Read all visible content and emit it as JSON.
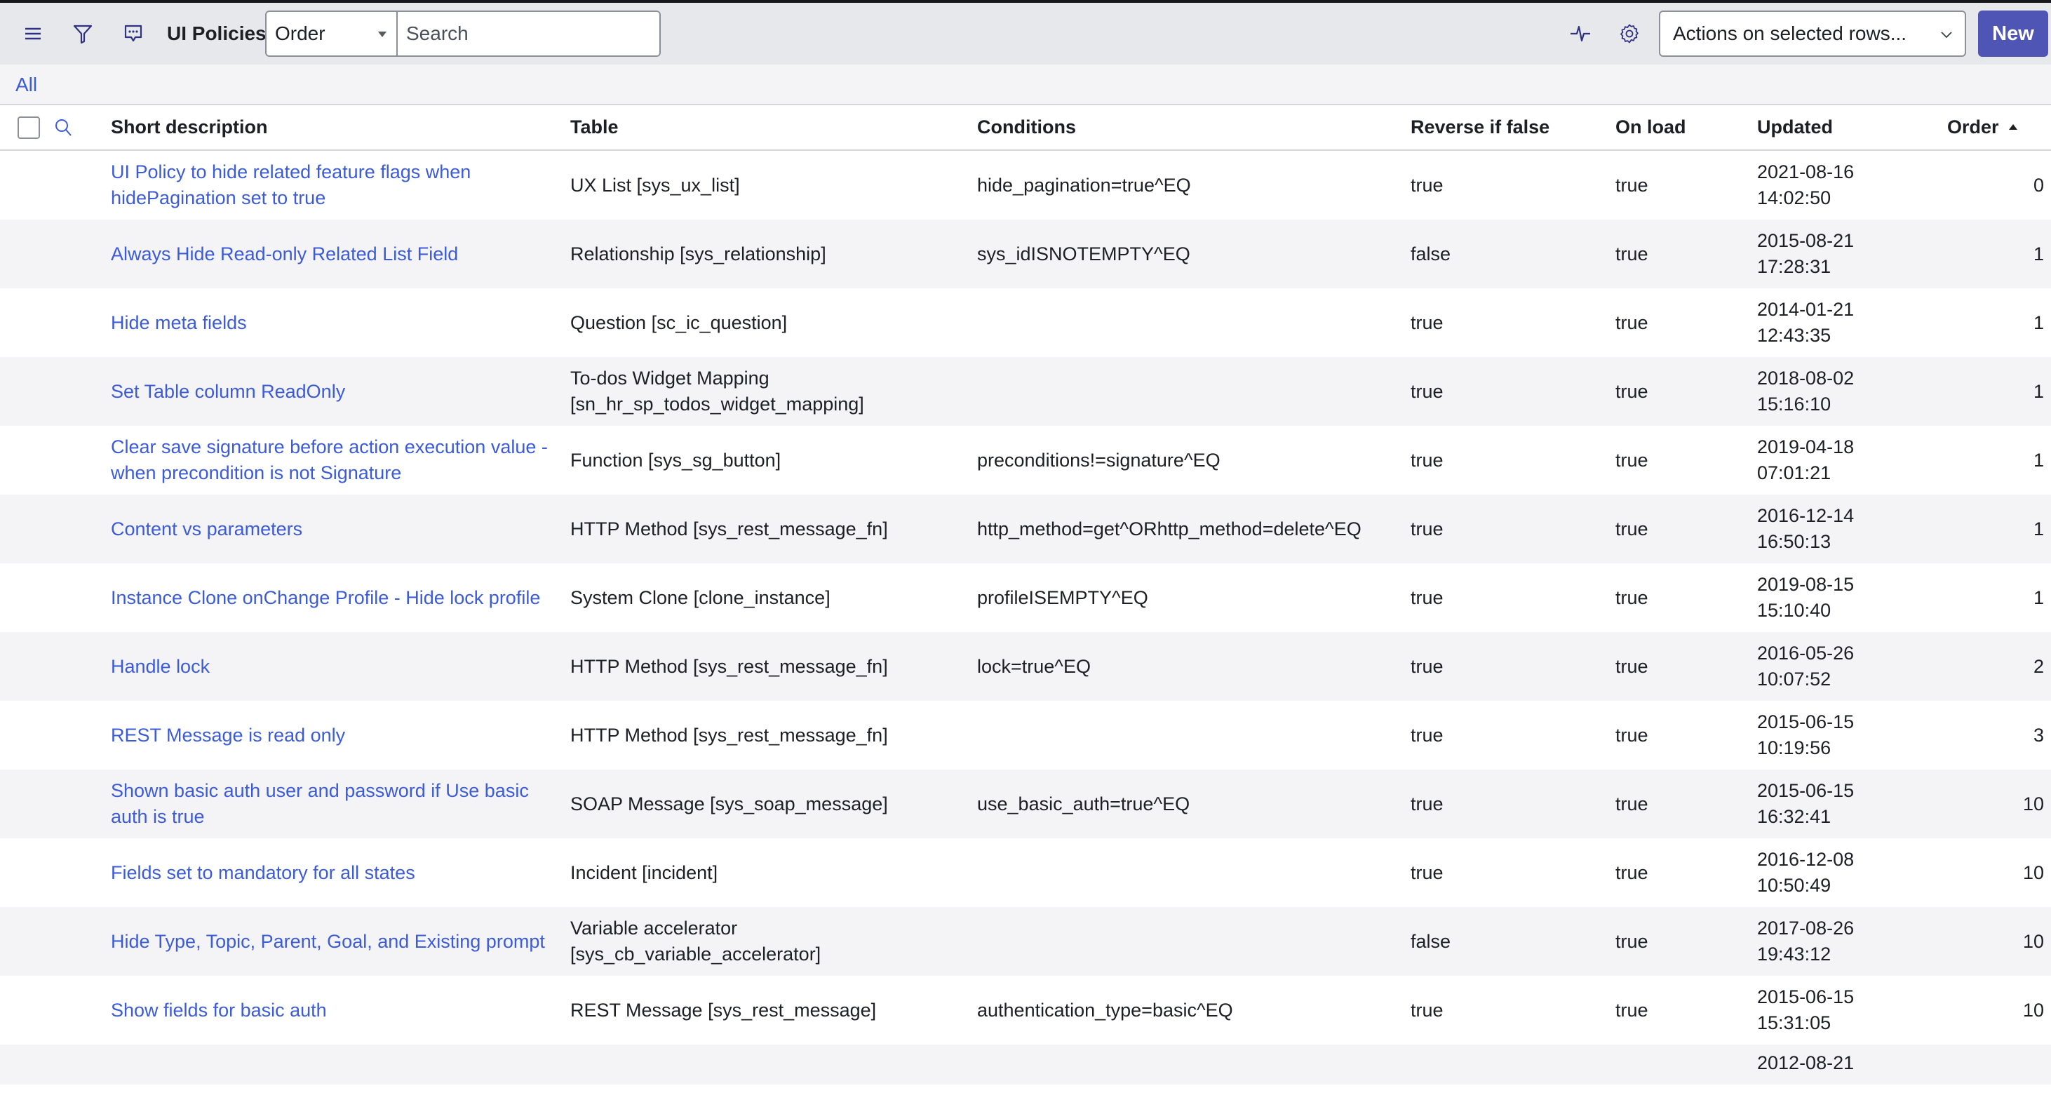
{
  "toolbar": {
    "menu_icon": "hamburger-menu-icon",
    "filter_icon": "filter-funnel-icon",
    "comment_icon": "chat-bubble-icon",
    "title": "UI Policies",
    "search_field_select": "Order",
    "search_placeholder": "Search",
    "pulse_icon": "activity-pulse-icon",
    "settings_icon": "gear-icon",
    "actions_select": "Actions on selected rows...",
    "new_button": "New"
  },
  "colors": {
    "link": "#3c5bd9",
    "primary_button": "#4f55b5",
    "toolbar_bg": "#e7e8ec",
    "stripe_bg": "#f4f4f6"
  },
  "filter": {
    "breadcrumb_all": "All"
  },
  "table": {
    "columns": [
      {
        "label": "Short description"
      },
      {
        "label": "Table"
      },
      {
        "label": "Conditions"
      },
      {
        "label": "Reverse if false"
      },
      {
        "label": "On load"
      },
      {
        "label": "Updated"
      },
      {
        "label": "Order",
        "sort": "ascending"
      }
    ],
    "rows": [
      {
        "short_description": "UI Policy to hide related feature flags when hidePagination set to true",
        "table": "UX List [sys_ux_list]",
        "conditions": "hide_pagination=true^EQ",
        "reverse_if_false": "true",
        "on_load": "true",
        "updated_date": "2021-08-16",
        "updated_time": "14:02:50",
        "order": "0"
      },
      {
        "short_description": "Always Hide Read-only Related List Field",
        "table": "Relationship [sys_relationship]",
        "conditions": "sys_idISNOTEMPTY^EQ",
        "reverse_if_false": "false",
        "on_load": "true",
        "updated_date": "2015-08-21",
        "updated_time": "17:28:31",
        "order": "1"
      },
      {
        "short_description": "Hide meta fields",
        "table": "Question [sc_ic_question]",
        "conditions": "",
        "reverse_if_false": "true",
        "on_load": "true",
        "updated_date": "2014-01-21",
        "updated_time": "12:43:35",
        "order": "1"
      },
      {
        "short_description": "Set Table column ReadOnly",
        "table": "To-dos Widget Mapping [sn_hr_sp_todos_widget_mapping]",
        "conditions": "",
        "reverse_if_false": "true",
        "on_load": "true",
        "updated_date": "2018-08-02",
        "updated_time": "15:16:10",
        "order": "1"
      },
      {
        "short_description": "Clear save signature before action execution value - when precondition is not Signature",
        "table": "Function [sys_sg_button]",
        "conditions": "preconditions!=signature^EQ",
        "reverse_if_false": "true",
        "on_load": "true",
        "updated_date": "2019-04-18",
        "updated_time": "07:01:21",
        "order": "1"
      },
      {
        "short_description": "Content vs parameters",
        "table": "HTTP Method [sys_rest_message_fn]",
        "conditions": "http_method=get^ORhttp_method=delete^EQ",
        "reverse_if_false": "true",
        "on_load": "true",
        "updated_date": "2016-12-14",
        "updated_time": "16:50:13",
        "order": "1"
      },
      {
        "short_description": "Instance Clone onChange Profile - Hide lock profile",
        "table": "System Clone [clone_instance]",
        "conditions": "profileISEMPTY^EQ",
        "reverse_if_false": "true",
        "on_load": "true",
        "updated_date": "2019-08-15",
        "updated_time": "15:10:40",
        "order": "1"
      },
      {
        "short_description": "Handle lock",
        "table": "HTTP Method [sys_rest_message_fn]",
        "conditions": "lock=true^EQ",
        "reverse_if_false": "true",
        "on_load": "true",
        "updated_date": "2016-05-26",
        "updated_time": "10:07:52",
        "order": "2"
      },
      {
        "short_description": "REST Message is read only",
        "table": "HTTP Method [sys_rest_message_fn]",
        "conditions": "",
        "reverse_if_false": "true",
        "on_load": "true",
        "updated_date": "2015-06-15",
        "updated_time": "10:19:56",
        "order": "3"
      },
      {
        "short_description": "Shown basic auth user and password if Use basic auth is true",
        "table": "SOAP Message [sys_soap_message]",
        "conditions": "use_basic_auth=true^EQ",
        "reverse_if_false": "true",
        "on_load": "true",
        "updated_date": "2015-06-15",
        "updated_time": "16:32:41",
        "order": "10"
      },
      {
        "short_description": "Fields set to mandatory for all states",
        "table": "Incident [incident]",
        "conditions": "",
        "reverse_if_false": "true",
        "on_load": "true",
        "updated_date": "2016-12-08",
        "updated_time": "10:50:49",
        "order": "10"
      },
      {
        "short_description": "Hide Type, Topic, Parent, Goal, and Existing prompt",
        "table": "Variable accelerator [sys_cb_variable_accelerator]",
        "conditions": "",
        "reverse_if_false": "false",
        "on_load": "true",
        "updated_date": "2017-08-26",
        "updated_time": "19:43:12",
        "order": "10"
      },
      {
        "short_description": "Show fields for basic auth",
        "table": "REST Message [sys_rest_message]",
        "conditions": "authentication_type=basic^EQ",
        "reverse_if_false": "true",
        "on_load": "true",
        "updated_date": "2015-06-15",
        "updated_time": "15:31:05",
        "order": "10"
      }
    ],
    "partial_row": {
      "updated_date": "2012-08-21"
    }
  }
}
